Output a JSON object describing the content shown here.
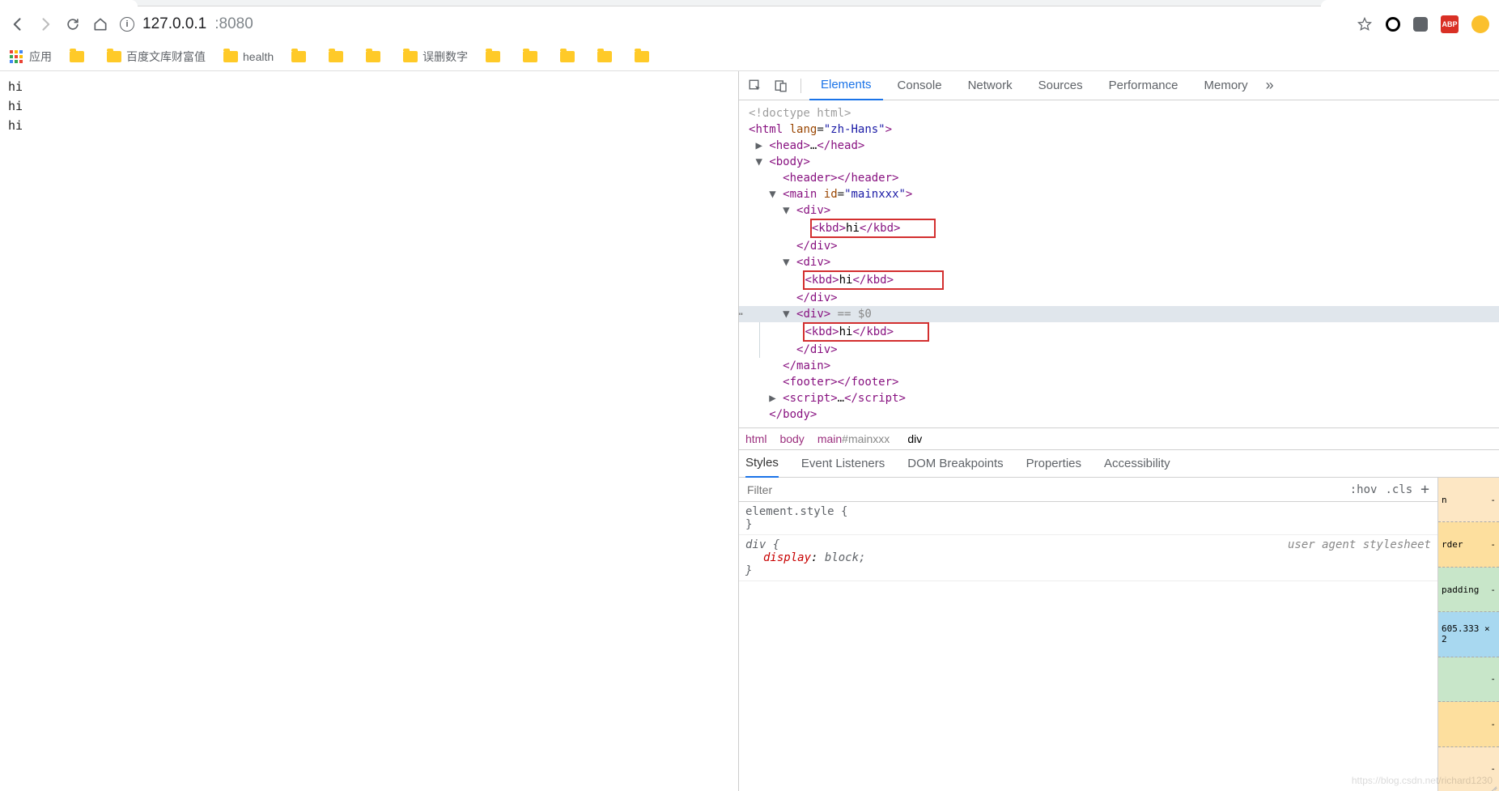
{
  "addr": {
    "host": "127.0.0.1",
    "port": ":8080"
  },
  "abp": "ABP",
  "bookmarks": {
    "apps": "应用",
    "items": [
      " ",
      "百度文库财富值",
      "health",
      " ",
      " ",
      " ",
      "误删数字",
      " ",
      " ",
      " ",
      " ",
      " "
    ]
  },
  "page": {
    "lines": [
      "hi",
      "hi",
      "hi"
    ]
  },
  "dt": {
    "tabs": [
      "Elements",
      "Console",
      "Network",
      "Sources",
      "Performance",
      "Memory"
    ],
    "subtabs": [
      "Styles",
      "Event Listeners",
      "DOM Breakpoints",
      "Properties",
      "Accessibility"
    ],
    "crumbs": [
      "html",
      "body",
      "main#mainxxx",
      "div"
    ],
    "filter_ph": "Filter",
    "hov": ":hov",
    "cls": ".cls",
    "rules": {
      "elstyle": "element.style {",
      "div": "div {",
      "display": "display",
      "block": "block;",
      "uas": "user agent stylesheet"
    },
    "box": {
      "margin": "n",
      "border": "rder",
      "padding": "padding",
      "content": "605.333 × 2",
      "dash": "-"
    }
  },
  "dom": {
    "doctype": "<!doctype html>",
    "html_open": [
      "<",
      "html",
      " ",
      "lang",
      "=",
      "\"zh-Hans\"",
      ">"
    ],
    "head": [
      "<",
      "head",
      ">",
      "…",
      "</",
      "head",
      ">"
    ],
    "body_open": [
      "<",
      "body",
      ">"
    ],
    "header": [
      "<",
      "header",
      ">",
      "</",
      "header",
      ">"
    ],
    "main_open": [
      "<",
      "main",
      " ",
      "id",
      "=",
      "\"mainxxx\"",
      ">"
    ],
    "div_open": [
      "<",
      "div",
      ">"
    ],
    "kbd": [
      "<",
      "kbd",
      ">",
      "hi",
      "</",
      "kbd",
      ">"
    ],
    "div_close": [
      "</",
      "div",
      ">"
    ],
    "div_sel": [
      "<",
      "div",
      ">",
      " == $0"
    ],
    "main_close": [
      "</",
      "main",
      ">"
    ],
    "footer": [
      "<",
      "footer",
      ">",
      "</",
      "footer",
      ">"
    ],
    "script": [
      "<",
      "script",
      ">",
      "…",
      "</",
      "script",
      ">"
    ],
    "body_close": [
      "</",
      "body",
      ">"
    ]
  },
  "watermark": "https://blog.csdn.net/richard1230"
}
